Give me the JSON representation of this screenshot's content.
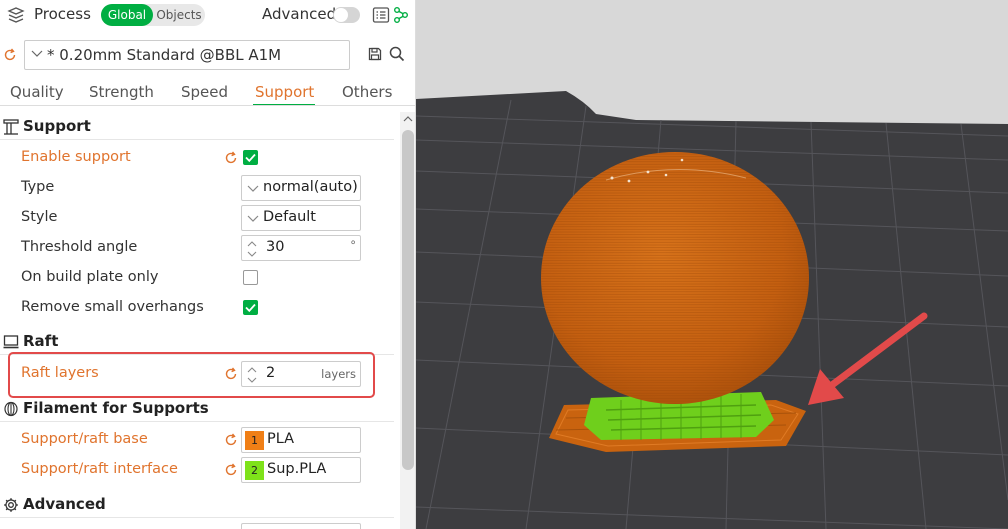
{
  "header": {
    "title": "Process",
    "scope_tabs": [
      "Global",
      "Objects"
    ],
    "advanced_label": "Advanced",
    "advanced_enabled": false
  },
  "preset": {
    "name": "* 0.20mm Standard @BBL A1M"
  },
  "tabs": [
    {
      "label": "Quality",
      "active": false
    },
    {
      "label": "Strength",
      "active": false
    },
    {
      "label": "Speed",
      "active": false
    },
    {
      "label": "Support",
      "active": true
    },
    {
      "label": "Others",
      "active": false
    }
  ],
  "sections": {
    "support": {
      "title": "Support",
      "enable_support": {
        "label": "Enable support",
        "checked": true
      },
      "type": {
        "label": "Type",
        "value": "normal(auto)"
      },
      "style": {
        "label": "Style",
        "value": "Default"
      },
      "threshold_angle": {
        "label": "Threshold angle",
        "value": "30",
        "unit": "°"
      },
      "build_plate_only": {
        "label": "On build plate only",
        "checked": false
      },
      "remove_small_overhangs": {
        "label": "Remove small overhangs",
        "checked": true
      }
    },
    "raft": {
      "title": "Raft",
      "raft_layers": {
        "label": "Raft layers",
        "value": "2",
        "unit": "layers"
      }
    },
    "filament": {
      "title": "Filament for Supports",
      "base": {
        "label": "Support/raft base",
        "slot": "1",
        "value": "PLA",
        "color": "#f07f16"
      },
      "interface": {
        "label": "Support/raft interface",
        "slot": "2",
        "value": "Sup.PLA",
        "color": "#7ee21a"
      }
    },
    "advanced": {
      "title": "Advanced"
    }
  },
  "colors": {
    "accent_green": "#00ae42",
    "modified_orange": "#e0742e",
    "highlight_red": "#e24a4a",
    "model_orange": "#c9630f",
    "support_green": "#6fcf1c",
    "bed_dark": "#3d3d40",
    "background_gray": "#d8d8d8"
  }
}
